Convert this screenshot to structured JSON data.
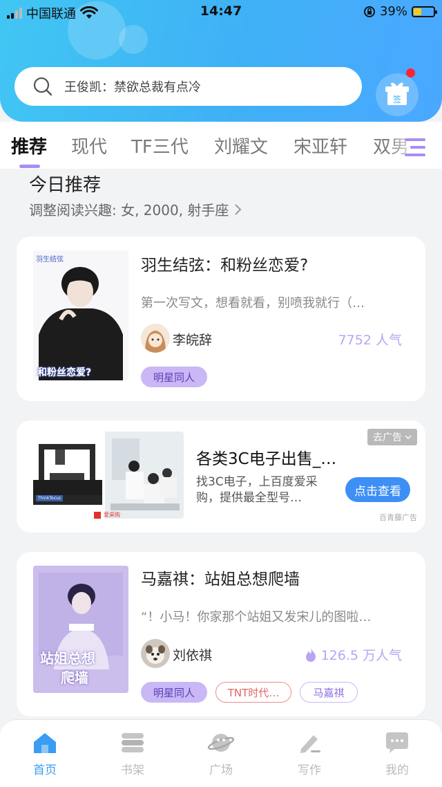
{
  "status_bar": {
    "carrier": "中国联通",
    "time": "14:47",
    "battery_percent": "39%",
    "battery_level": 0.39
  },
  "search": {
    "placeholder": "王俊凯：禁欲总裁有点冷",
    "search_icon": "search-icon",
    "checkin_icon": "gift-icon",
    "checkin_label": "签"
  },
  "tabs": [
    "推荐",
    "现代",
    "TF三代",
    "刘耀文",
    "宋亚轩",
    "双男"
  ],
  "active_tab": "推荐",
  "section": {
    "title": "今日推荐",
    "prefs": "调整阅读兴趣: 女, 2000, 射手座"
  },
  "books": [
    {
      "cover_text_top": "羽生结弦",
      "cover_text_bottom": "和粉丝恋爱?",
      "title": "羽生结弦：和粉丝恋爱?",
      "desc": "第一次写文，想看就看，别喷我就行（…",
      "author": "李皖辞",
      "popularity": "7752 人气",
      "hot": false,
      "tags": [
        "明星同人"
      ]
    },
    {
      "cover_text_top": "站姐总想",
      "cover_text_bottom": "爬墙",
      "title": "马嘉祺：站姐总想爬墙",
      "desc": "“！小马！你家那个站姐又发宋儿的图啦…",
      "author": "刘依祺",
      "popularity": "126.5 万人气",
      "hot": true,
      "tags": [
        "明星同人",
        "TNT时代…",
        "马嘉祺"
      ]
    }
  ],
  "ad": {
    "close_label": "去广告",
    "title": "各类3C电子出售_…",
    "desc": "找3C电子，上百度爱采购，提供最全型号…",
    "button": "点击查看",
    "source": "百青藤广告",
    "logo_label": "爱采购",
    "machine_label": "ThinkTocus"
  },
  "bottom_nav": [
    {
      "label": "首页",
      "icon": "home-icon",
      "active": true
    },
    {
      "label": "书架",
      "icon": "bookshelf-icon",
      "active": false
    },
    {
      "label": "广场",
      "icon": "planet-icon",
      "active": false
    },
    {
      "label": "写作",
      "icon": "pen-icon",
      "active": false
    },
    {
      "label": "我的",
      "icon": "chat-bubble-icon",
      "active": false
    }
  ],
  "colors": {
    "header": "#41c6f3",
    "accent": "#a98df2",
    "tag_fill": "#c9b7f6",
    "popularity": "#b9a4f1",
    "nav_active": "#3a9cf3",
    "ad_button": "#3d8ff5"
  }
}
